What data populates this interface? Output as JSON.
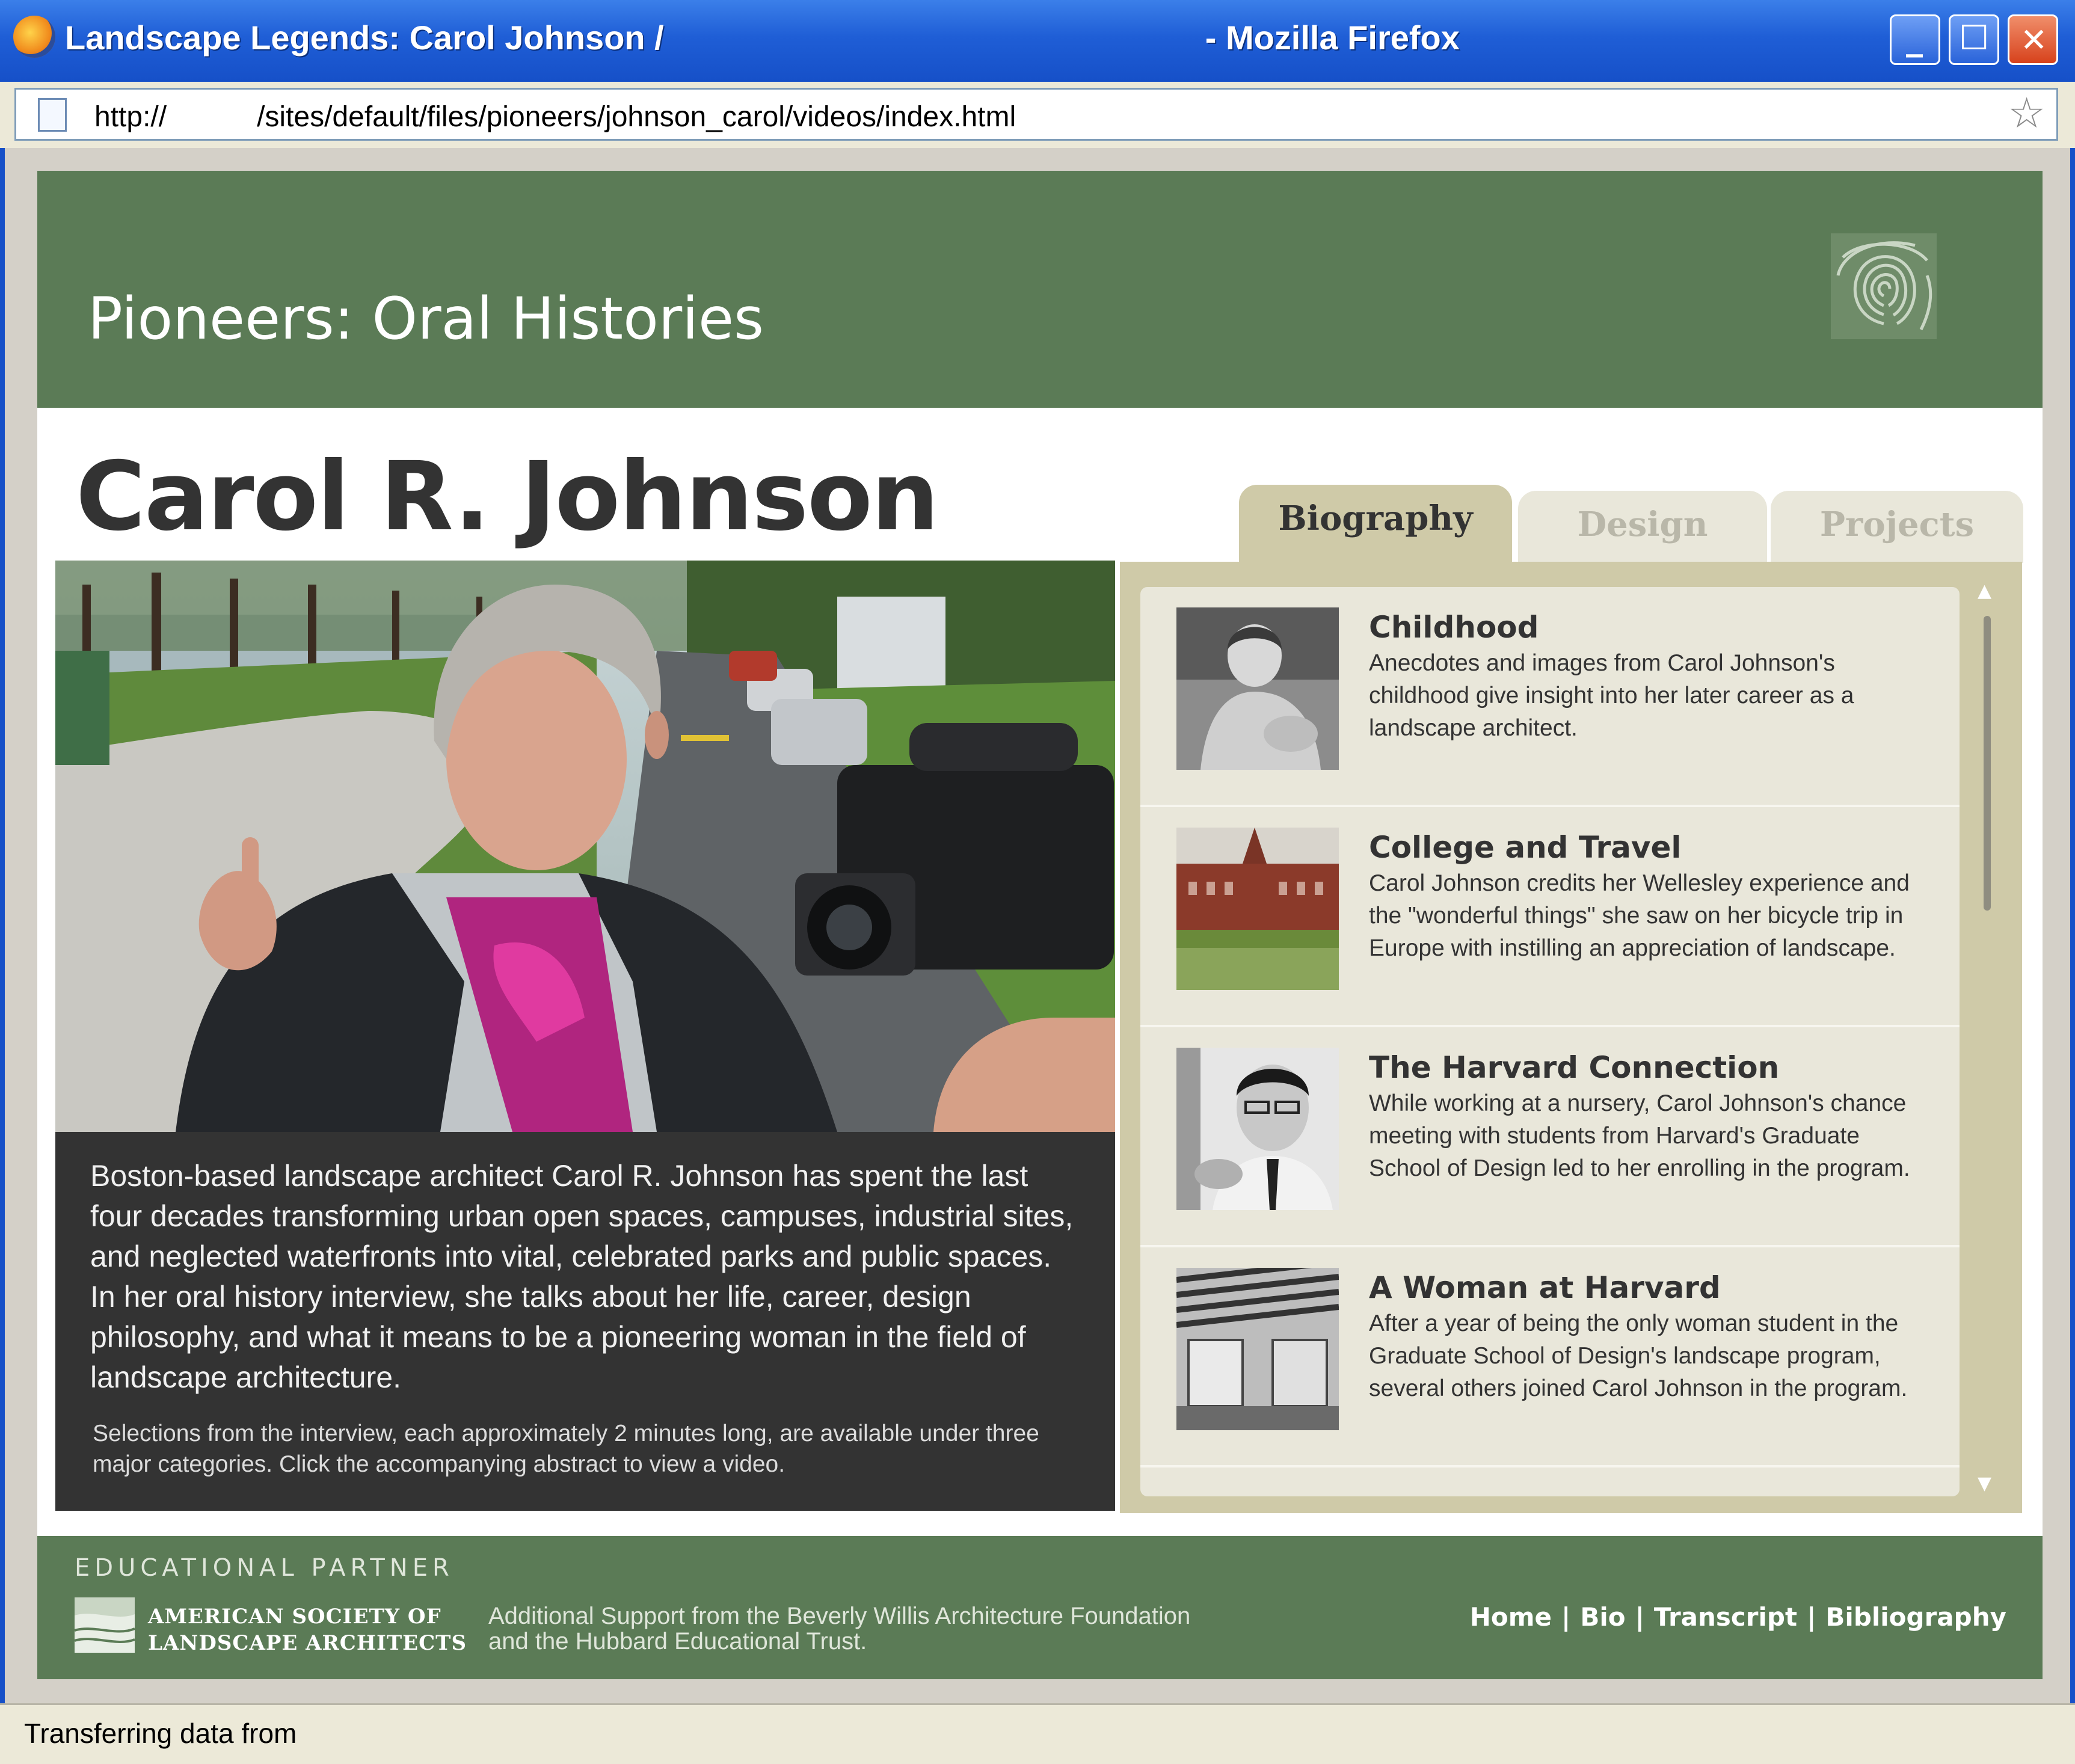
{
  "window": {
    "title_left": "Landscape Legends: Carol Johnson /",
    "title_right": "- Mozilla Firefox",
    "minimize_glyph": "_",
    "maximize_glyph": "☐",
    "close_glyph": "✕"
  },
  "address_bar": {
    "url_scheme": "http://",
    "url_path": "/sites/default/files/pioneers/johnson_carol/videos/index.html",
    "star_glyph": "☆"
  },
  "header": {
    "title": "Pioneers: Oral Histories"
  },
  "profile": {
    "name": "Carol R. Johnson",
    "intro": "Boston-based landscape architect Carol R. Johnson has spent the last four decades transforming urban open spaces, campuses, industrial sites, and neglected waterfronts into vital, celebrated parks and public spaces. In her oral history interview, she talks about her life, career, design philosophy, and what it means to be a pioneering woman in the field of landscape architecture.",
    "note": "Selections from the interview, each approximately 2 minutes long, are available under three major categories. Click the accompanying abstract to view a video."
  },
  "tabs": [
    {
      "label": "Biography",
      "active": true
    },
    {
      "label": "Design",
      "active": false
    },
    {
      "label": "Projects",
      "active": false
    }
  ],
  "items": [
    {
      "title": "Childhood",
      "description": "Anecdotes and images from Carol Johnson's childhood give insight into her later career as a landscape architect."
    },
    {
      "title": "College and Travel",
      "description": "Carol Johnson credits her Wellesley experience and the \"wonderful things\" she saw on her bicycle trip in Europe with instilling an appreciation of landscape."
    },
    {
      "title": "The Harvard Connection",
      "description": "While working at a nursery, Carol Johnson's chance meeting with students from Harvard's Graduate School of Design led to her enrolling in the program."
    },
    {
      "title": "A Woman at Harvard",
      "description": "After a year of being the only woman student in the Graduate School of Design's landscape program, several others joined Carol Johnson in the program."
    }
  ],
  "scrollbar": {
    "up_glyph": "▲",
    "down_glyph": "▼"
  },
  "footer": {
    "partner_label": "EDUCATIONAL PARTNER",
    "asla_line1": "AMERICAN SOCIETY OF",
    "asla_line2": "LANDSCAPE ARCHITECTS",
    "support": "Additional Support from the Beverly Willis Architecture Foundation and  the Hubbard Educational Trust.",
    "nav": [
      "Home",
      "Bio",
      "Transcript",
      "Bibliography"
    ],
    "separator": "|"
  },
  "status_bar": {
    "text": "Transferring data from"
  },
  "colors": {
    "header_green": "#5b7b56",
    "panel_tan": "#cfcaa8",
    "panel_inner": "#e9e7da",
    "intro_bg": "#333333"
  },
  "icons": [
    "firefox-icon",
    "page-icon",
    "bookmark-star-icon",
    "fingerprint-icon",
    "asla-logo-icon"
  ]
}
